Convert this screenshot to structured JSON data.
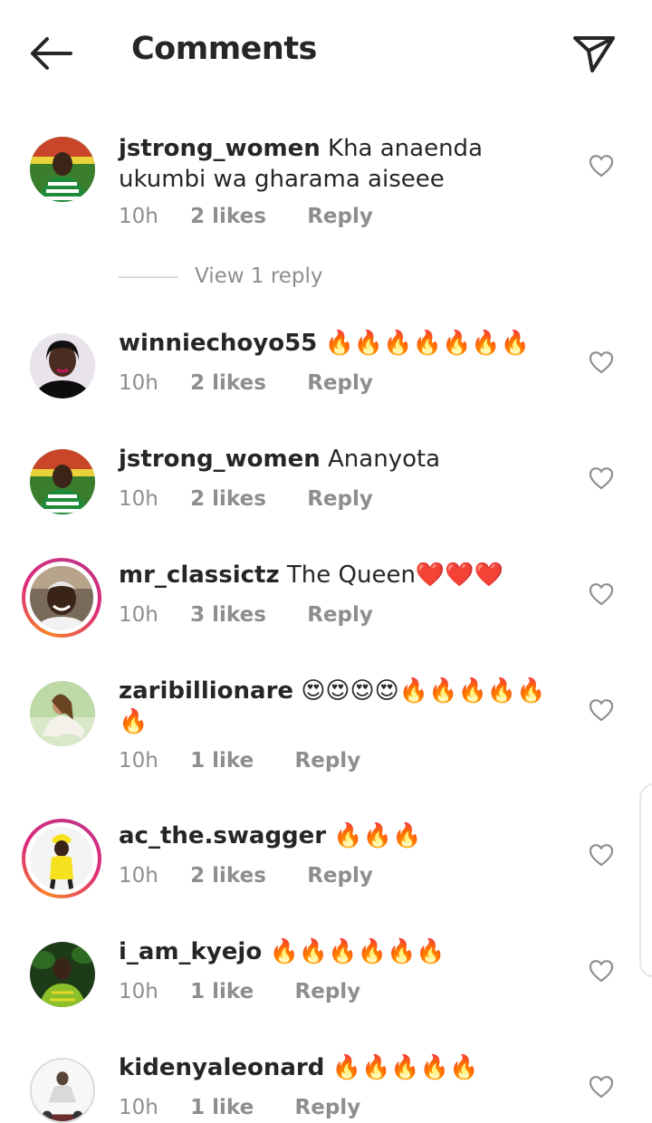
{
  "header": {
    "title": "Comments"
  },
  "view_replies_label": "View 1 reply",
  "icons": {
    "back": "arrow-left-icon",
    "share": "paper-plane-icon",
    "like": "heart-outline-icon"
  },
  "colors": {
    "story_ring_start": "#f58529",
    "story_ring_end": "#dd2a7b",
    "meta_gray": "#8e8e8e"
  },
  "comments": [
    {
      "username": "jstrong_women",
      "text": "Kha anaenda ukumbi wa gharama aiseee",
      "time": "10h",
      "likes": "2 likes",
      "reply": "Reply"
    },
    {
      "username": "winniechoyo55",
      "text": "🔥🔥🔥🔥🔥🔥🔥",
      "time": "10h",
      "likes": "2 likes",
      "reply": "Reply"
    },
    {
      "username": "jstrong_women",
      "text": "Ananyota",
      "time": "10h",
      "likes": "2 likes",
      "reply": "Reply"
    },
    {
      "username": "mr_classictz",
      "text": "The Queen❤️❤️❤️",
      "time": "10h",
      "likes": "3 likes",
      "reply": "Reply"
    },
    {
      "username": "zaribillionare",
      "text": "😍😍😍😍🔥🔥🔥🔥🔥🔥",
      "time": "10h",
      "likes": "1 like",
      "reply": "Reply"
    },
    {
      "username": "ac_the.swagger",
      "text": "🔥🔥🔥",
      "time": "10h",
      "likes": "2 likes",
      "reply": "Reply"
    },
    {
      "username": "i_am_kyejo",
      "text": "🔥🔥🔥🔥🔥🔥",
      "time": "10h",
      "likes": "1 like",
      "reply": "Reply"
    },
    {
      "username": "kidenyaleonard",
      "text": "🔥🔥🔥🔥🔥",
      "time": "10h",
      "likes": "1 like",
      "reply": "Reply"
    }
  ]
}
